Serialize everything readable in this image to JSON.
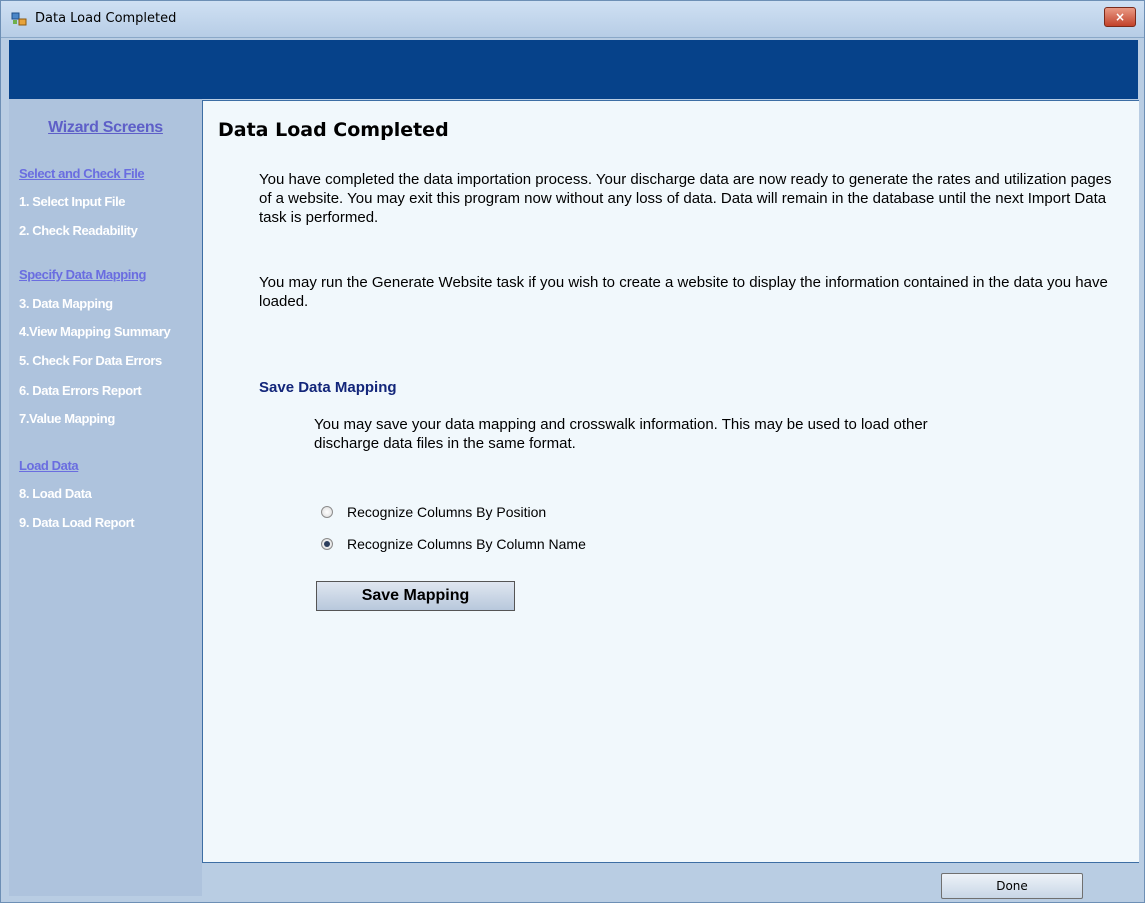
{
  "window": {
    "title": "Data Load Completed",
    "close_label": "×"
  },
  "sidebar": {
    "heading": "Wizard Screens",
    "sections": [
      {
        "label": "Select and Check File",
        "steps": [
          "1. Select Input File",
          "2. Check Readability"
        ]
      },
      {
        "label": "Specify Data Mapping",
        "steps": [
          "3. Data Mapping",
          "4.View Mapping Summary",
          "5. Check For Data Errors",
          "6. Data Errors Report",
          "7.Value Mapping"
        ]
      },
      {
        "label": "Load Data",
        "steps": [
          "8. Load Data",
          "9. Data Load Report"
        ]
      }
    ]
  },
  "main": {
    "title": "Data Load Completed",
    "paragraph1": "You have completed the data importation process.  Your discharge data are now ready to generate the rates and utilization pages of a website.  You may exit this program now without any loss of data.  Data will remain in the database until the next Import Data task is performed.",
    "paragraph2": "You may run the Generate Website task if you wish to create a website to display the information contained in the data you have loaded.",
    "save_section": {
      "heading": "Save Data Mapping",
      "description": "You may save your data mapping and crosswalk information.  This may be used to load other discharge data files in the same format.",
      "options": [
        {
          "label": "Recognize Columns By Position",
          "selected": false
        },
        {
          "label": "Recognize Columns By Column Name",
          "selected": true
        }
      ],
      "button_label": "Save Mapping"
    }
  },
  "footer": {
    "done_label": "Done"
  },
  "colors": {
    "banner": "#06428a",
    "sidebar": "#aec3dd",
    "section_link": "#6a6de0",
    "subheading": "#13267a"
  }
}
